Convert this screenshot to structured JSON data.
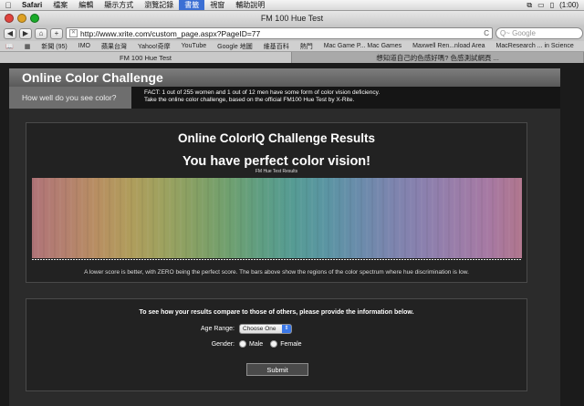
{
  "menubar": {
    "items": [
      "Safari",
      "檔案",
      "編輯",
      "顯示方式",
      "瀏覽記錄",
      "書籤",
      "視窗",
      "輔助說明"
    ],
    "active_index": 5,
    "battery": "(1:00)"
  },
  "window": {
    "title": "FM 100 Hue Test",
    "traffic_colors": [
      "#e0443e",
      "#dea123",
      "#1aab29"
    ]
  },
  "toolbar": {
    "back_label": "◀",
    "forward_label": "▶",
    "home_label": "⌂",
    "add_label": "+",
    "url": "http://www.xrite.com/custom_page.aspx?PageID=77",
    "reload_label": "C",
    "search_placeholder": "Q~ Google"
  },
  "bookmarks": [
    "新聞 (95)",
    "IMO",
    "蘋果台灣",
    "Yahoo!奇摩",
    "YouTube",
    "Google 地圖",
    "維基百科",
    "熱門",
    "Mac Game P... Mac Games",
    "Maxwell Ren...nload Area",
    "MacResearch ... in Science"
  ],
  "tabs": [
    {
      "label": "FM 100 Hue Test",
      "active": true
    },
    {
      "label": "想知道自己的色感好嗎? 色感測試網頁 ...",
      "active": false
    }
  ],
  "site": {
    "header": "Online Color Challenge",
    "subtab": "How well do you see color?",
    "fact_line1": "FACT: 1 out of 255 women and 1 out of 12 men have some form of color vision deficiency.",
    "fact_line2": "Take the online color challenge, based on the official FM100 Hue Test by X-Rite."
  },
  "results": {
    "title": "Online ColorIQ Challenge Results",
    "verdict": "You have perfect color vision!",
    "chart_label": "FM Hue Test Results",
    "caption": "A lower score is better, with ZERO being the perfect score. The bars above show the regions of the color spectrum where hue discrimination is low.",
    "spectrum_colors": [
      "#b07478",
      "#b4806f",
      "#b88f62",
      "#b09d5c",
      "#9ea25f",
      "#86a064",
      "#70a06f",
      "#5f9e82",
      "#569c94",
      "#5b95a3",
      "#6a8cab",
      "#7c85ae",
      "#8b80ae",
      "#9a7da9",
      "#a779a3",
      "#b0768d"
    ]
  },
  "compare": {
    "intro": "To see how your results compare to those of others, please provide the information below.",
    "age_label": "Age Range:",
    "age_value": "Choose One",
    "gender_label": "Gender:",
    "male_label": "Male",
    "female_label": "Female",
    "submit_label": "Submit"
  }
}
